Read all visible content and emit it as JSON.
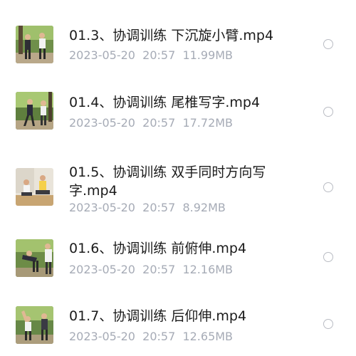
{
  "files": [
    {
      "name": "01.3、协调训练 下沉旋小臂.mp4",
      "date": "2023-05-20",
      "time": "20:57",
      "size": "11.99MB"
    },
    {
      "name": "01.4、协调训练 尾椎写字.mp4",
      "date": "2023-05-20",
      "time": "20:57",
      "size": "17.72MB"
    },
    {
      "name": "01.5、协调训练 双手同时方向写字.mp4",
      "date": "2023-05-20",
      "time": "20:57",
      "size": "8.92MB"
    },
    {
      "name": "01.6、协调训练 前俯伸.mp4",
      "date": "2023-05-20",
      "time": "20:57",
      "size": "12.16MB"
    },
    {
      "name": "01.7、协调训练 后仰伸.mp4",
      "date": "2023-05-20",
      "time": "20:57",
      "size": "12.65MB"
    }
  ],
  "colors": {
    "title": "#1b1b1b",
    "meta": "#a6abb6",
    "radio_border": "#b9bcc3"
  }
}
